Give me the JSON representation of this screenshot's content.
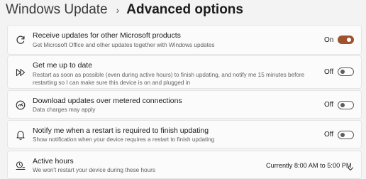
{
  "breadcrumb": {
    "parent": "Windows Update",
    "separator": "›",
    "current": "Advanced options"
  },
  "settings": [
    {
      "icon": "sync-icon",
      "title": "Receive updates for other Microsoft products",
      "description": "Get Microsoft Office and other updates together with Windows updates",
      "state_label": "On",
      "toggle_on": true
    },
    {
      "icon": "fast-forward-icon",
      "title": "Get me up to date",
      "description": "Restart as soon as possible (even during active hours) to finish updating, and notify me 15 minutes before restarting so I can make sure this device is on and plugged in",
      "state_label": "Off",
      "toggle_on": false
    },
    {
      "icon": "metered-gauge-icon",
      "title": "Download updates over metered connections",
      "description": "Data charges may apply",
      "state_label": "Off",
      "toggle_on": false
    },
    {
      "icon": "bell-icon",
      "title": "Notify me when a restart is required to finish updating",
      "description": "Show notification when your device requires a restart to finish updating",
      "state_label": "Off",
      "toggle_on": false
    },
    {
      "icon": "active-hours-icon",
      "title": "Active hours",
      "description": "We won't restart your device during these hours",
      "value": "Currently 8:00 AM to 5:00 PM"
    }
  ],
  "colors": {
    "accent": "#a0522d",
    "background": "#f3f3f3",
    "card": "#fbfbfb"
  }
}
